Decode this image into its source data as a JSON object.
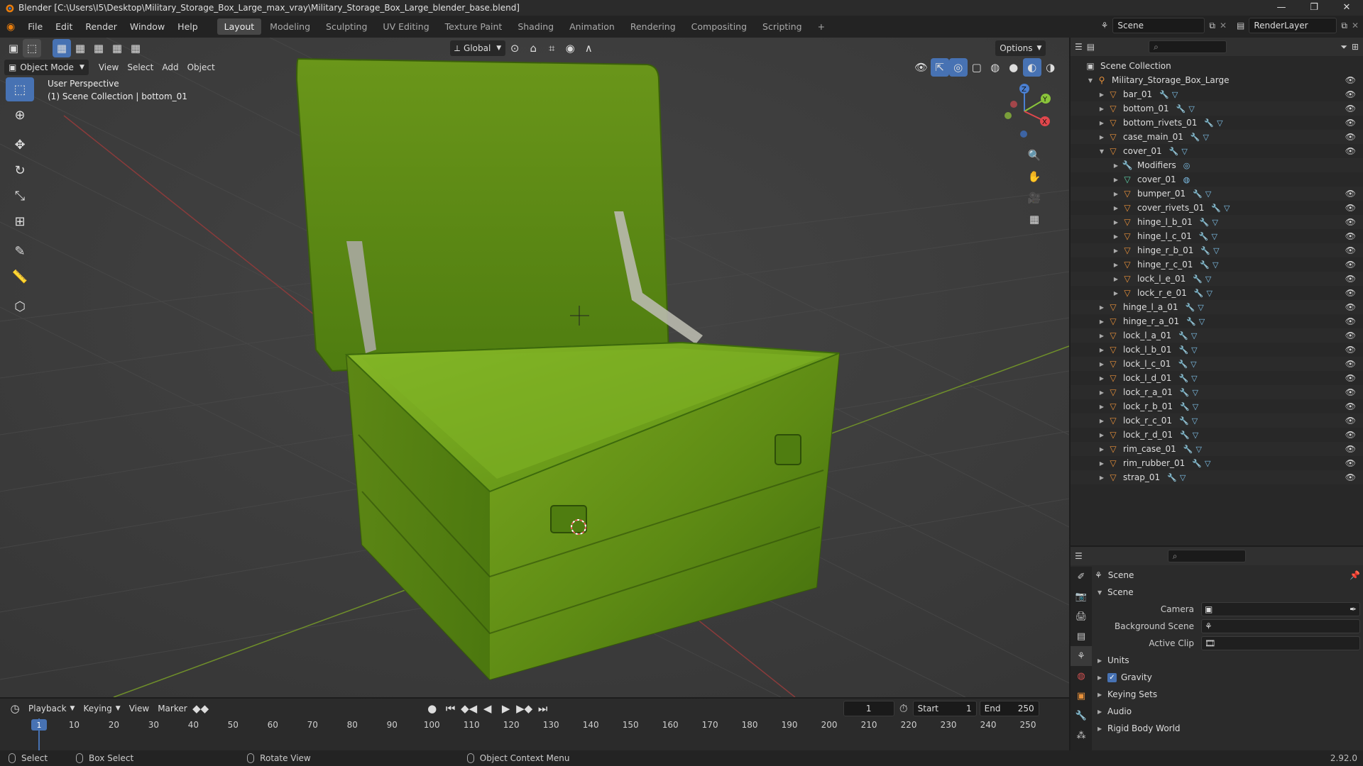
{
  "window": {
    "title": "Blender [C:\\Users\\I5\\Desktop\\Military_Storage_Box_Large_max_vray\\Military_Storage_Box_Large_blender_base.blend]"
  },
  "menu": {
    "items": [
      "File",
      "Edit",
      "Render",
      "Window",
      "Help"
    ],
    "workspaces": [
      "Layout",
      "Modeling",
      "Sculpting",
      "UV Editing",
      "Texture Paint",
      "Shading",
      "Animation",
      "Rendering",
      "Compositing",
      "Scripting"
    ],
    "active_workspace": "Layout",
    "scene": "Scene",
    "render_layer": "RenderLayer"
  },
  "viewport": {
    "mode": "Object Mode",
    "menus": [
      "View",
      "Select",
      "Add",
      "Object"
    ],
    "orientation": "Global",
    "options_label": "Options",
    "perspective": "User Perspective",
    "collection_info": "(1) Scene Collection | bottom_01",
    "gizmo_axes": [
      "X",
      "Y",
      "Z"
    ]
  },
  "outliner": {
    "root": "Scene Collection",
    "collection": "Military_Storage_Box_Large",
    "items": [
      {
        "name": "bar_01",
        "level": 1,
        "icon": "object"
      },
      {
        "name": "bottom_01",
        "level": 1,
        "icon": "object"
      },
      {
        "name": "bottom_rivets_01",
        "level": 1,
        "icon": "object"
      },
      {
        "name": "case_main_01",
        "level": 1,
        "icon": "object"
      },
      {
        "name": "cover_01",
        "level": 1,
        "icon": "object"
      },
      {
        "name": "Modifiers",
        "level": 2,
        "icon": "modifier"
      },
      {
        "name": "cover_01",
        "level": 2,
        "icon": "mesh"
      },
      {
        "name": "bumper_01",
        "level": 2,
        "icon": "object"
      },
      {
        "name": "cover_rivets_01",
        "level": 2,
        "icon": "object"
      },
      {
        "name": "hinge_l_b_01",
        "level": 2,
        "icon": "object"
      },
      {
        "name": "hinge_l_c_01",
        "level": 2,
        "icon": "object"
      },
      {
        "name": "hinge_r_b_01",
        "level": 2,
        "icon": "object"
      },
      {
        "name": "hinge_r_c_01",
        "level": 2,
        "icon": "object"
      },
      {
        "name": "lock_l_e_01",
        "level": 2,
        "icon": "object"
      },
      {
        "name": "lock_r_e_01",
        "level": 2,
        "icon": "object"
      },
      {
        "name": "hinge_l_a_01",
        "level": 1,
        "icon": "object"
      },
      {
        "name": "hinge_r_a_01",
        "level": 1,
        "icon": "object"
      },
      {
        "name": "lock_l_a_01",
        "level": 1,
        "icon": "object"
      },
      {
        "name": "lock_l_b_01",
        "level": 1,
        "icon": "object"
      },
      {
        "name": "lock_l_c_01",
        "level": 1,
        "icon": "object"
      },
      {
        "name": "lock_l_d_01",
        "level": 1,
        "icon": "object"
      },
      {
        "name": "lock_r_a_01",
        "level": 1,
        "icon": "object"
      },
      {
        "name": "lock_r_b_01",
        "level": 1,
        "icon": "object"
      },
      {
        "name": "lock_r_c_01",
        "level": 1,
        "icon": "object"
      },
      {
        "name": "lock_r_d_01",
        "level": 1,
        "icon": "object"
      },
      {
        "name": "rim_case_01",
        "level": 1,
        "icon": "object"
      },
      {
        "name": "rim_rubber_01",
        "level": 1,
        "icon": "object"
      },
      {
        "name": "strap_01",
        "level": 1,
        "icon": "object"
      }
    ]
  },
  "properties": {
    "context": "Scene",
    "panel": "Scene",
    "camera_label": "Camera",
    "background_scene_label": "Background Scene",
    "active_clip_label": "Active Clip",
    "sections": [
      "Units",
      "Gravity",
      "Keying Sets",
      "Audio",
      "Rigid Body World"
    ],
    "gravity_checked": true
  },
  "timeline": {
    "menus": [
      "Playback",
      "Keying",
      "View",
      "Marker"
    ],
    "current_frame": "1",
    "start_label": "Start",
    "start": "1",
    "end_label": "End",
    "end": "250",
    "ticks": [
      "1",
      "10",
      "20",
      "30",
      "40",
      "50",
      "60",
      "70",
      "80",
      "90",
      "100",
      "110",
      "120",
      "130",
      "140",
      "150",
      "160",
      "170",
      "180",
      "190",
      "200",
      "210",
      "220",
      "230",
      "240",
      "250"
    ]
  },
  "statusbar": {
    "items": [
      "Select",
      "Box Select",
      "Rotate View",
      "Object Context Menu"
    ],
    "version": "2.92.0"
  },
  "colors": {
    "accent": "#4772b3",
    "object_icon": "#e8913a",
    "mesh_icon": "#5fd1a9",
    "box_green": "#6a9a1c"
  }
}
